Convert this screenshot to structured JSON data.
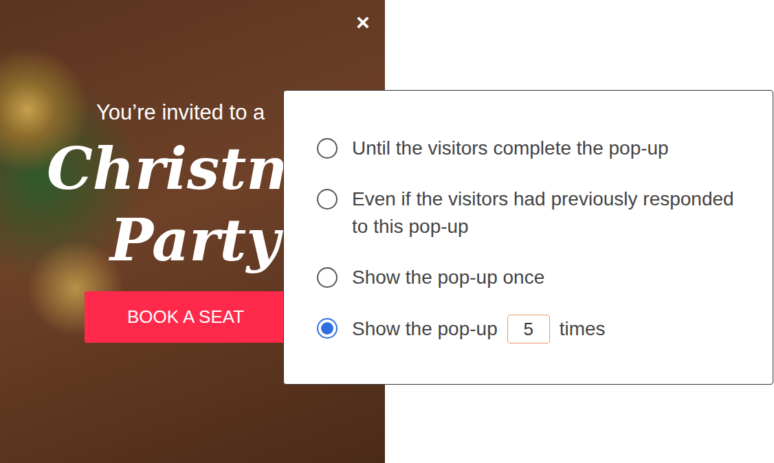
{
  "preview": {
    "close": "×",
    "invite": "You’re invited to a",
    "headline": [
      "Christma",
      "Party"
    ],
    "button": "BOOK A SEAT"
  },
  "frequency_panel": {
    "options": [
      {
        "kind": "text",
        "label": "Until the visitors complete the pop-up",
        "selected": false
      },
      {
        "kind": "text",
        "label": "Even if the visitors had previously responded to this pop-up",
        "selected": false
      },
      {
        "kind": "text",
        "label": "Show the pop-up once",
        "selected": false
      },
      {
        "kind": "count",
        "label": "Show the pop-up",
        "value": "5",
        "suffix": "times",
        "selected": true
      }
    ]
  }
}
